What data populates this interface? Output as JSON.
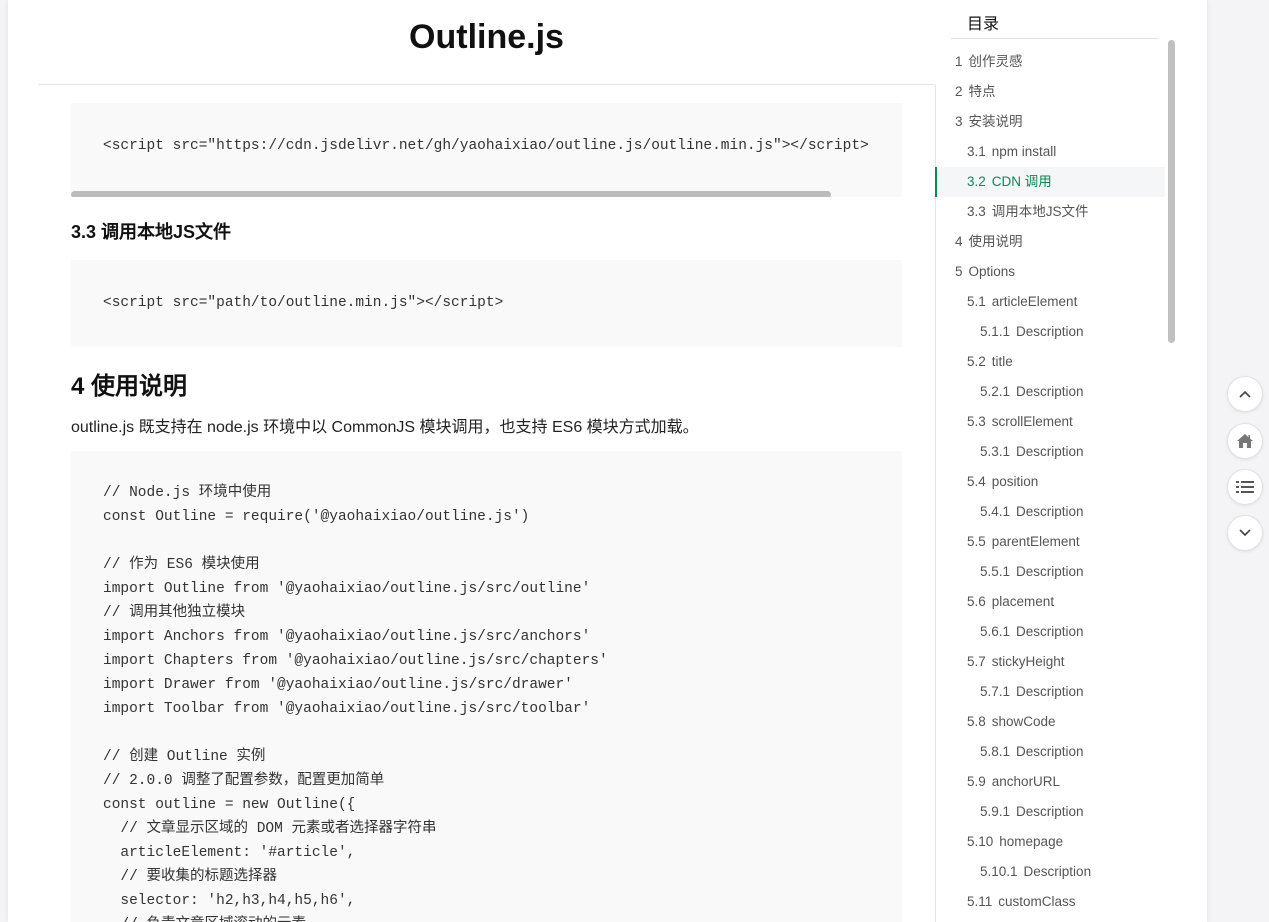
{
  "title": "Outline.js",
  "code_block_1": [
    "<script src=\"https://cdn.jsdelivr.net/gh/yaohaixiao/outline.js/outline.min.js\"></script>"
  ],
  "heading_3_3": "3.3 调用本地JS文件",
  "code_block_2": [
    "<script src=\"path/to/outline.min.js\"></script>"
  ],
  "heading_4": "4 使用说明",
  "paragraph": "outline.js 既支持在 node.js 环境中以 CommonJS 模块调用，也支持 ES6 模块方式加载。",
  "code_block_3": [
    "// Node.js 环境中使用",
    "const Outline = require('@yaohaixiao/outline.js')",
    "",
    "// 作为 ES6 模块使用",
    "import Outline from '@yaohaixiao/outline.js/src/outline'",
    "// 调用其他独立模块",
    "import Anchors from '@yaohaixiao/outline.js/src/anchors'",
    "import Chapters from '@yaohaixiao/outline.js/src/chapters'",
    "import Drawer from '@yaohaixiao/outline.js/src/drawer'",
    "import Toolbar from '@yaohaixiao/outline.js/src/toolbar'",
    "",
    "// 创建 Outline 实例",
    "// 2.0.0 调整了配置参数，配置更加简单",
    "const outline = new Outline({",
    "  // 文章显示区域的 DOM 元素或者选择器字符串",
    "  articleElement: '#article',",
    "  // 要收集的标题选择器",
    "  selector: 'h2,h3,h4,h5,h6',",
    "  // 负责文章区域滚动的元素"
  ],
  "toc": {
    "title": "目录",
    "active_color": "#0a8a55",
    "items": [
      {
        "num": "1",
        "label": "创作灵感",
        "level": 1
      },
      {
        "num": "2",
        "label": "特点",
        "level": 1
      },
      {
        "num": "3",
        "label": "安装说明",
        "level": 1
      },
      {
        "num": "3.1",
        "label": "npm install",
        "level": 2
      },
      {
        "num": "3.2",
        "label": "CDN 调用",
        "level": 2,
        "active": true
      },
      {
        "num": "3.3",
        "label": "调用本地JS文件",
        "level": 2
      },
      {
        "num": "4",
        "label": "使用说明",
        "level": 1
      },
      {
        "num": "5",
        "label": "Options",
        "level": 1
      },
      {
        "num": "5.1",
        "label": "articleElement",
        "level": 2
      },
      {
        "num": "5.1.1",
        "label": "Description",
        "level": 3
      },
      {
        "num": "5.2",
        "label": "title",
        "level": 2
      },
      {
        "num": "5.2.1",
        "label": "Description",
        "level": 3
      },
      {
        "num": "5.3",
        "label": "scrollElement",
        "level": 2
      },
      {
        "num": "5.3.1",
        "label": "Description",
        "level": 3
      },
      {
        "num": "5.4",
        "label": "position",
        "level": 2
      },
      {
        "num": "5.4.1",
        "label": "Description",
        "level": 3
      },
      {
        "num": "5.5",
        "label": "parentElement",
        "level": 2
      },
      {
        "num": "5.5.1",
        "label": "Description",
        "level": 3
      },
      {
        "num": "5.6",
        "label": "placement",
        "level": 2
      },
      {
        "num": "5.6.1",
        "label": "Description",
        "level": 3
      },
      {
        "num": "5.7",
        "label": "stickyHeight",
        "level": 2
      },
      {
        "num": "5.7.1",
        "label": "Description",
        "level": 3
      },
      {
        "num": "5.8",
        "label": "showCode",
        "level": 2
      },
      {
        "num": "5.8.1",
        "label": "Description",
        "level": 3
      },
      {
        "num": "5.9",
        "label": "anchorURL",
        "level": 2
      },
      {
        "num": "5.9.1",
        "label": "Description",
        "level": 3
      },
      {
        "num": "5.10",
        "label": "homepage",
        "level": 2
      },
      {
        "num": "5.10.1",
        "label": "Description",
        "level": 3
      },
      {
        "num": "5.11",
        "label": "customClass",
        "level": 2
      }
    ]
  },
  "toolbar": [
    {
      "icon": "chevron-up-icon"
    },
    {
      "icon": "home-icon"
    },
    {
      "icon": "list-icon"
    },
    {
      "icon": "chevron-down-icon"
    }
  ]
}
